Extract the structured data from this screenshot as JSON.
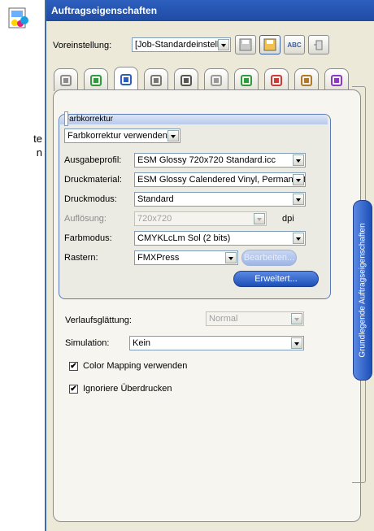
{
  "background_text": {
    "line1": "te",
    "line2": "n"
  },
  "window": {
    "title": "Auftragseigenschaften"
  },
  "preset": {
    "label": "Voreinstellung:",
    "value": "[Job-Standardeinstellun"
  },
  "toolbar": {
    "icons": [
      "save-icon",
      "save-as-icon",
      "abc-icon",
      "delete-icon"
    ]
  },
  "tabs": [
    "general-tab",
    "layout-tab",
    "color-tab",
    "media-tab",
    "cut-tab",
    "tile-tab",
    "step-tab",
    "marks-tab",
    "layers-tab",
    "edit-tab"
  ],
  "group": {
    "title": "Farbkorrektur",
    "mode": "Farbkorrektur verwenden",
    "rows": [
      {
        "label": "Ausgabeprofil:",
        "value": "ESM Glossy 720x720 Standard.icc"
      },
      {
        "label": "Druckmaterial:",
        "value": "ESM Glossy Calendered Vinyl, Permanent Ac"
      },
      {
        "label": "Druckmodus:",
        "value": "Standard"
      },
      {
        "label": "Auflösung:",
        "value": "720x720",
        "unit": "dpi"
      },
      {
        "label": "Farbmodus:",
        "value": "CMYKLcLm Sol (2 bits)"
      },
      {
        "label": "Rastern:",
        "value": "FMXPress",
        "button": "Bearbeiten..."
      }
    ],
    "advanced_button": "Erweitert..."
  },
  "smoothing": {
    "label": "Verlaufsglättung:",
    "value": "Normal"
  },
  "simulation": {
    "label": "Simulation:",
    "value": "Kein"
  },
  "checkboxes": [
    {
      "label": "Color Mapping verwenden",
      "checked": "✔"
    },
    {
      "label": "Ignoriere Überdrucken",
      "checked": "✔"
    }
  ],
  "side_tab": "Grundlegende Auftragseigenschaften",
  "colors": {
    "title_bar": "#2d5fbf",
    "accent": "#1c4fb7",
    "panel": "#ece9d8"
  }
}
